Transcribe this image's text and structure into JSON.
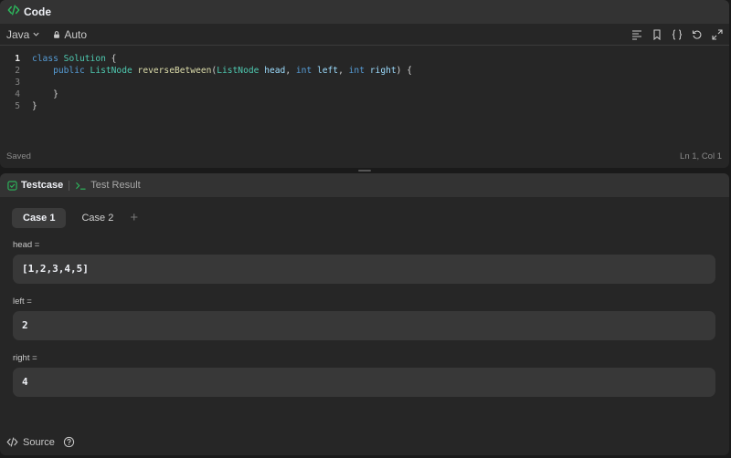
{
  "code_panel": {
    "title": "Code",
    "language": "Java",
    "mode": "Auto",
    "status_left": "Saved",
    "status_right": "Ln 1, Col 1",
    "icons": [
      "format-icon",
      "bookmark-icon",
      "braces-icon",
      "reset-icon",
      "expand-icon"
    ],
    "lines": [
      {
        "number": "1",
        "tokens": [
          {
            "t": "class",
            "c": "kw"
          },
          {
            "t": " "
          },
          {
            "t": "Solution",
            "c": "cls"
          },
          {
            "t": " {"
          }
        ]
      },
      {
        "number": "2",
        "tokens": [
          {
            "t": "    "
          },
          {
            "t": "public",
            "c": "kw"
          },
          {
            "t": " "
          },
          {
            "t": "ListNode",
            "c": "cls"
          },
          {
            "t": " "
          },
          {
            "t": "reverseBetween",
            "c": "fn"
          },
          {
            "t": "("
          },
          {
            "t": "ListNode",
            "c": "cls"
          },
          {
            "t": " "
          },
          {
            "t": "head",
            "c": "var"
          },
          {
            "t": ", "
          },
          {
            "t": "int",
            "c": "kw"
          },
          {
            "t": " "
          },
          {
            "t": "left",
            "c": "var"
          },
          {
            "t": ", "
          },
          {
            "t": "int",
            "c": "kw"
          },
          {
            "t": " "
          },
          {
            "t": "right",
            "c": "var"
          },
          {
            "t": ") {"
          }
        ]
      },
      {
        "number": "3",
        "tokens": [
          {
            "t": "        "
          }
        ]
      },
      {
        "number": "4",
        "tokens": [
          {
            "t": "    }"
          }
        ]
      },
      {
        "number": "5",
        "tokens": [
          {
            "t": "}"
          }
        ]
      }
    ]
  },
  "test_panel": {
    "tabs": [
      {
        "label": "Testcase",
        "active": true
      },
      {
        "label": "Test Result",
        "active": false
      }
    ],
    "cases": [
      "Case 1",
      "Case 2"
    ],
    "add_case_label": "+",
    "params": [
      {
        "label": "head =",
        "value": "[1,2,3,4,5]"
      },
      {
        "label": "left =",
        "value": "2"
      },
      {
        "label": "right =",
        "value": "4"
      }
    ],
    "footer_label": "Source"
  },
  "colors": {
    "accent_green": "#2cbb5d",
    "keyword": "#569cd6",
    "class_name": "#4ec9b0",
    "function_name": "#dcdcaa",
    "variable": "#9cdcfe"
  }
}
